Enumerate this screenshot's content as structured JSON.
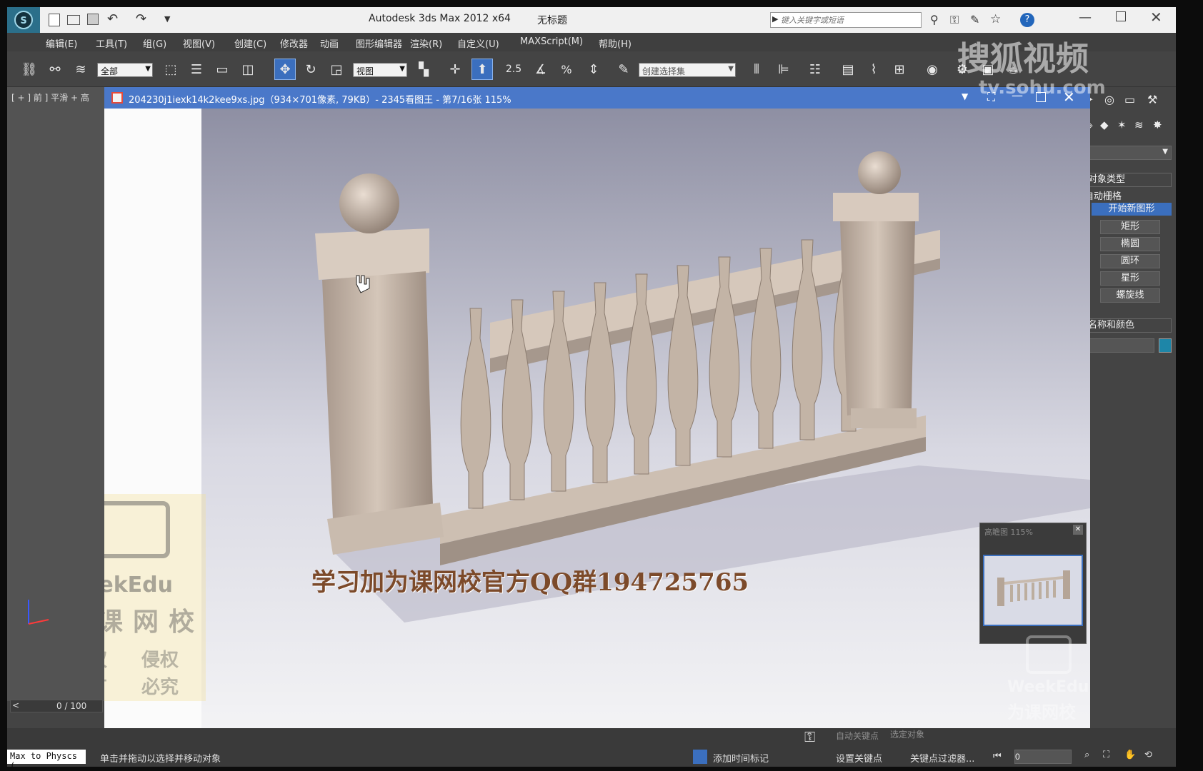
{
  "window": {
    "app_title": "Autodesk 3ds Max  2012 x64",
    "doc_title": "无标题",
    "search_placeholder": "键入关键字或短语",
    "help_label": "?"
  },
  "menu": [
    "编辑(E)",
    "工具(T)",
    "组(G)",
    "视图(V)",
    "创建(C)",
    "修改器",
    "动画",
    "图形编辑器",
    "渲染(R)",
    "自定义(U)",
    "MAXScript(M)",
    "帮助(H)"
  ],
  "toolbar": {
    "selection_filter": "全部",
    "ref_coord": "视图",
    "snap_label": "2.5",
    "percent_label": "%",
    "named_selection": "创建选择集"
  },
  "viewport": {
    "label": "[ + ] 前 ] 平滑 + 高"
  },
  "viewer": {
    "title": "204230j1iexk14k2kee9xs.jpg（934×701像素, 79KB）- 2345看图王 - 第7/16张 115%",
    "caption": "学习加为课网校官方QQ群194725765",
    "thumb_title": "高瞻图 115%"
  },
  "command_panel": {
    "section1": "对象类型",
    "autogrid": "自动栅格",
    "start_new_shape": "开始新图形",
    "buttons": [
      "矩形",
      "椭圆",
      "圆环",
      "星形",
      "螺旋线"
    ],
    "section2": "名称和颜色",
    "accent": "#1e86a8"
  },
  "status": {
    "frame_counter": "0 / 100",
    "script_listener": "Max to Physcs (",
    "prompt": "单击并拖动以选择并移动对象",
    "add_time_tag": "添加时间标记",
    "set_key": "设置关键点",
    "key_filters": "关键点过滤器...",
    "frame_value": "0",
    "selected_dropdown": "选定对象",
    "auto_key": "自动关键点"
  },
  "watermarks": {
    "sohu": "搜狐视频",
    "sohu_url": "tv.sohu.com",
    "weekedu": "WeekEdu",
    "weekedu_cn": "为课网校",
    "copyright_1": "版权",
    "copyright_2": "侵权",
    "copyright_3": "所有",
    "copyright_4": "必究"
  }
}
